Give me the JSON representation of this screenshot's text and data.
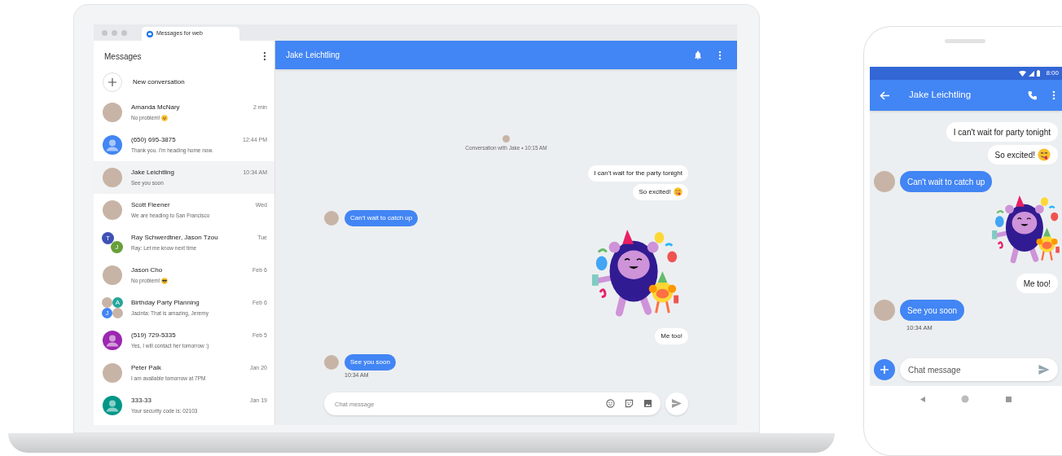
{
  "browser": {
    "tab_title": "Messages for web"
  },
  "sidebar": {
    "title": "Messages",
    "new_conversation": "New conversation",
    "conversations": [
      {
        "name": "Amanda McNary",
        "snippet": "No problem!",
        "emoji": {
          "kind": "grin"
        },
        "time": "2 min",
        "avatar": {
          "kind": "photo"
        },
        "selected": false
      },
      {
        "name": "(650) 695-3875",
        "snippet": "Thank you. I'm heading home now.",
        "time": "12:44 PM",
        "avatar": {
          "kind": "contact",
          "color": "#4285f4"
        },
        "selected": false
      },
      {
        "name": "Jake Leichtling",
        "snippet": "See you soon",
        "time": "10:34 AM",
        "avatar": {
          "kind": "photo"
        },
        "selected": true
      },
      {
        "name": "Scott Fleener",
        "snippet": "We are heading to San Francisco",
        "time": "Wed",
        "avatar": {
          "kind": "photo"
        },
        "selected": false
      },
      {
        "name": "Ray Schwerdtner, Jason Tzou",
        "snippet": "Ray: Let me know next time",
        "time": "Tue",
        "avatar": {
          "kind": "pair",
          "members": [
            {
              "initial": "T",
              "color": "#3f51b5"
            },
            {
              "initial": "J",
              "color": "#689f38"
            }
          ]
        },
        "selected": false
      },
      {
        "name": "Jason Cho",
        "snippet": "No problem!",
        "emoji": {
          "kind": "cool"
        },
        "time": "Feb 6",
        "avatar": {
          "kind": "photo"
        },
        "selected": false
      },
      {
        "name": "Birthday Party Planning",
        "snippet": "Jacinta: That is amazing, Jeremy",
        "time": "Feb 6",
        "avatar": {
          "kind": "quad",
          "members": [
            {
              "kind": "photo"
            },
            {
              "initial": "A",
              "color": "#26a69a"
            },
            {
              "initial": "J",
              "color": "#4285f4"
            },
            {
              "kind": "photo"
            }
          ]
        },
        "selected": false
      },
      {
        "name": "(519) 729-5335",
        "snippet": "Yes, I will contact her tomorrow :)",
        "time": "Feb 5",
        "avatar": {
          "kind": "contact",
          "color": "#9c27b0"
        },
        "selected": false
      },
      {
        "name": "Peter Paik",
        "snippet": "I am available tomorrow at 7PM",
        "time": "Jan 20",
        "avatar": {
          "kind": "photo"
        },
        "selected": false
      },
      {
        "name": "333-33",
        "snippet": "Your security code is: 02103",
        "time": "Jan 19",
        "avatar": {
          "kind": "contact",
          "color": "#009688"
        },
        "selected": false
      }
    ]
  },
  "chat": {
    "title": "Jake Leichtling",
    "conversation_start": "Conversation with Jake • 10:15 AM",
    "messages": [
      {
        "kind": "outgoing",
        "text": "I can't wait for the party tonight"
      },
      {
        "kind": "outgoing",
        "text": "So excited!",
        "emoji": {
          "kind": "yum"
        }
      },
      {
        "kind": "incoming",
        "text": "Can't wait to catch up"
      },
      {
        "kind": "sticker"
      },
      {
        "kind": "outgoing",
        "text": "Me too!"
      },
      {
        "kind": "incoming",
        "text": "See you soon",
        "time": "10:34 AM"
      }
    ],
    "composer": {
      "placeholder": "Chat message"
    }
  },
  "phone": {
    "status_time": "8:00",
    "title": "Jake Leichtling",
    "messages": [
      {
        "kind": "outgoing",
        "text": "I can't wait for party tonight"
      },
      {
        "kind": "outgoing",
        "text": "So excited!",
        "emoji": {
          "kind": "yum"
        }
      },
      {
        "kind": "incoming",
        "text": "Can't wait to catch up"
      },
      {
        "kind": "sticker"
      },
      {
        "kind": "outgoing",
        "text": "Me too!"
      },
      {
        "kind": "incoming",
        "text": "See you soon",
        "time": "10:34 AM"
      }
    ],
    "composer": {
      "placeholder": "Chat message"
    }
  }
}
